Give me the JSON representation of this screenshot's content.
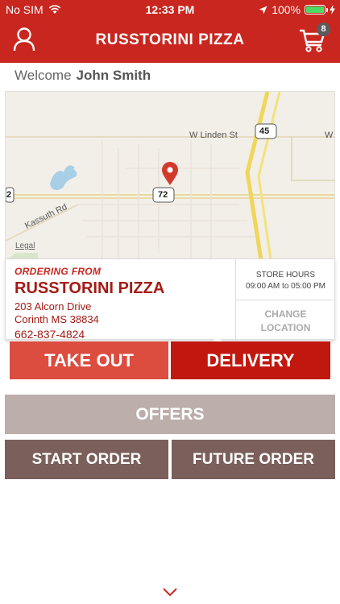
{
  "status_bar": {
    "carrier": "No SIM",
    "time": "12:33 PM",
    "battery": "100%"
  },
  "nav": {
    "title": "RUSSTORINI PIZZA",
    "cart_count": "8",
    "icons": {
      "user": "user-icon",
      "cart": "cart-icon"
    }
  },
  "welcome": {
    "greeting": "Welcome",
    "name": "John Smith"
  },
  "map": {
    "labels": {
      "linden": "W Linden St",
      "kassuth": "Kassuth Rd",
      "route45": "45",
      "route72": "72",
      "route2": "2",
      "w": "W",
      "legal": "Legal"
    }
  },
  "store": {
    "ordering_from": "ORDERING FROM",
    "name": "RUSSTORINI PIZZA",
    "address_line1": "203 Alcorn Drive",
    "address_line2": "Corinth MS 38834",
    "phone": "662-837-4824",
    "hours_title": "STORE HOURS",
    "hours_value": "09:00 AM to 05:00 PM",
    "change_line1": "CHANGE",
    "change_line2": "LOCATION"
  },
  "buttons": {
    "takeout": "TAKE OUT",
    "delivery": "DELIVERY",
    "offers": "OFFERS",
    "start_order": "START ORDER",
    "future_order": "FUTURE ORDER"
  },
  "colors": {
    "header": "#c9261f",
    "takeout": "#dc4c3f",
    "delivery": "#c0180f",
    "offers": "#bcaeab",
    "order_buttons": "#7a5f5a"
  }
}
